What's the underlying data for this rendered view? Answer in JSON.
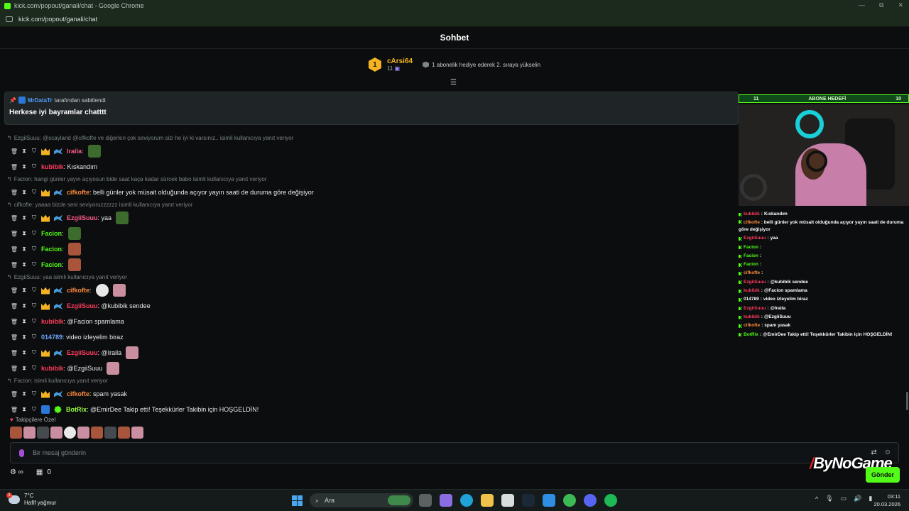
{
  "window": {
    "title": "kick.com/popout/ganali/chat - Google Chrome",
    "url": "kick.com/popout/ganali/chat",
    "min": "—",
    "restore": "⧉",
    "close": "✕"
  },
  "header": {
    "title": "Sohbet"
  },
  "leaderboard": {
    "rank": "1",
    "username": "cArsi64",
    "count": "11",
    "gift_text": "1 abonelik hediye ederek 2. sıraya yükselin"
  },
  "pinned": {
    "by_user": "MrDataTr",
    "by_text": "tarafından sabitlendi",
    "message": "Herkese iyi bayramlar chatttt"
  },
  "messages": [
    {
      "reply": "EzgiiSuuu: @scayland @cifkofte ve diğerleri çok seviyorum sizi he iyi ki varsınız.. isimli kullanıcıya yanıt veriyor"
    },
    {
      "user": "Iraila",
      "text": "",
      "color": "u-pink",
      "badges": [
        "crown",
        "gift"
      ],
      "emotes": [
        "em-green"
      ]
    },
    {
      "user": "kubibik",
      "text": "Kıskandım",
      "color": "u-red",
      "badges": [],
      "emotes": []
    },
    {
      "reply": "Facion: hangi günler yayın açıyosun bide saat kaça kadar sürcek babo isimli kullanıcıya yanıt veriyor"
    },
    {
      "user": "cifkofte",
      "text": "belli günler yok müsait olduğunda açıyor yayın saati de duruma göre değişiyor",
      "color": "u-orange",
      "badges": [
        "crown",
        "gift"
      ],
      "emotes": []
    },
    {
      "reply": "cifkofte: yaaaa bizde seni seviyoruzzzzzz isimli kullanıcıya yanıt veriyor"
    },
    {
      "user": "EzgiiSuuu",
      "text": "yaa",
      "color": "u-pink",
      "badges": [
        "crown",
        "gift"
      ],
      "emotes": [
        "em-green"
      ]
    },
    {
      "user": "Facion",
      "text": "",
      "color": "u-green",
      "badges": [],
      "emotes": [
        "em-green"
      ]
    },
    {
      "user": "Facion",
      "text": "",
      "color": "u-green",
      "badges": [],
      "emotes": [
        "em-face"
      ]
    },
    {
      "user": "Facion",
      "text": "",
      "color": "u-green",
      "badges": [],
      "emotes": [
        "em-face"
      ]
    },
    {
      "reply": "EzgiiSuuu: yaa isimli kullanıcıya yanıt veriyor"
    },
    {
      "user": "cifkofte",
      "text": "",
      "color": "u-orange",
      "badges": [
        "crown",
        "gift"
      ],
      "emotes": [
        "em-white",
        "em-pink"
      ]
    },
    {
      "user": "EzgiiSuuu",
      "text": "@kubibik sendee",
      "color": "u-red",
      "badges": [
        "crown",
        "gift"
      ],
      "emotes": []
    },
    {
      "user": "kubibik",
      "text": "@Facion spamlama",
      "color": "u-red",
      "badges": [],
      "emotes": []
    },
    {
      "user": "014789",
      "text": "video izleyelim biraz",
      "color": "u-blue",
      "badges": [],
      "emotes": []
    },
    {
      "user": "EzgiiSuuu",
      "text": "@Iraila",
      "color": "u-red",
      "badges": [
        "crown",
        "gift"
      ],
      "emotes": [
        "em-pink"
      ]
    },
    {
      "user": "kubibik",
      "text": "@EzgiiSuuu",
      "color": "u-red",
      "badges": [],
      "emotes": [
        "em-pink"
      ]
    },
    {
      "reply": "Facion: isimli kullanıcıya yanıt veriyor"
    },
    {
      "user": "cifkofte",
      "text": "spam yasak",
      "color": "u-orange",
      "badges": [
        "crown",
        "gift"
      ],
      "emotes": []
    },
    {
      "user": "BotRix",
      "text": "@EmirDee Takip etti! Teşekkürler Takibin için HOŞGELDİN!",
      "color": "u-lime",
      "badges": [
        "bot",
        "verify"
      ],
      "emotes": []
    }
  ],
  "followers_only": "Takipçilere Özel",
  "emote_bar": [
    "em-face",
    "em-pink",
    "em-dark",
    "em-pink",
    "em-white",
    "em-pink",
    "em-face",
    "em-dark",
    "em-face",
    "em-pink"
  ],
  "input": {
    "placeholder": "Bir mesaj gönderin"
  },
  "bottom": {
    "points": "0",
    "send": "Gönder"
  },
  "overlay": {
    "goal_left": "11",
    "goal_title": "ABONE HEDEFİ",
    "goal_right": "10",
    "goal_progress": 1.0,
    "chat": [
      {
        "user": "kubibik",
        "text": "Kıskandım",
        "color": "#ff3b5c"
      },
      {
        "user": "cifkofte",
        "text": "belli günler yok müsait olduğunda açıyor yayın saati de duruma göre değişiyor",
        "color": "#ff8a3d"
      },
      {
        "user": "EzgiiSuuu",
        "text": "yaa",
        "color": "#ff3b5c"
      },
      {
        "user": "Facion",
        "text": "",
        "color": "#53fc18"
      },
      {
        "user": "Facion",
        "text": "",
        "color": "#53fc18"
      },
      {
        "user": "Facion",
        "text": "",
        "color": "#53fc18"
      },
      {
        "user": "cifkofte",
        "text": "",
        "color": "#ff8a3d"
      },
      {
        "user": "EzgiiSuuu",
        "text": "@kubibik sendee",
        "color": "#ff3b5c"
      },
      {
        "user": "kubibik",
        "text": "@Facion spamlama",
        "color": "#ff3b5c"
      },
      {
        "user": "014789",
        "text": "video izleyelim biraz",
        "color": "#ffffff"
      },
      {
        "user": "EzgiiSuuu",
        "text": "@Iraila",
        "color": "#ff3b5c"
      },
      {
        "user": "kubibik",
        "text": "@EzgiiSuuu",
        "color": "#ff3b5c"
      },
      {
        "user": "cifkofte",
        "text": "spam yasak",
        "color": "#ff8a3d"
      },
      {
        "user": "BotRix",
        "text": "@EmirDee Takip etti! Teşekkürler Takibin için HOŞGELDİN!",
        "color": "#53fc18"
      }
    ],
    "watermark": "ByNoGame"
  },
  "taskbar": {
    "temp": "7°C",
    "weather": "Hafif yağmur",
    "weather_badge": "3",
    "search": "Ara",
    "time": "03:11",
    "date": "20.03.2026"
  }
}
